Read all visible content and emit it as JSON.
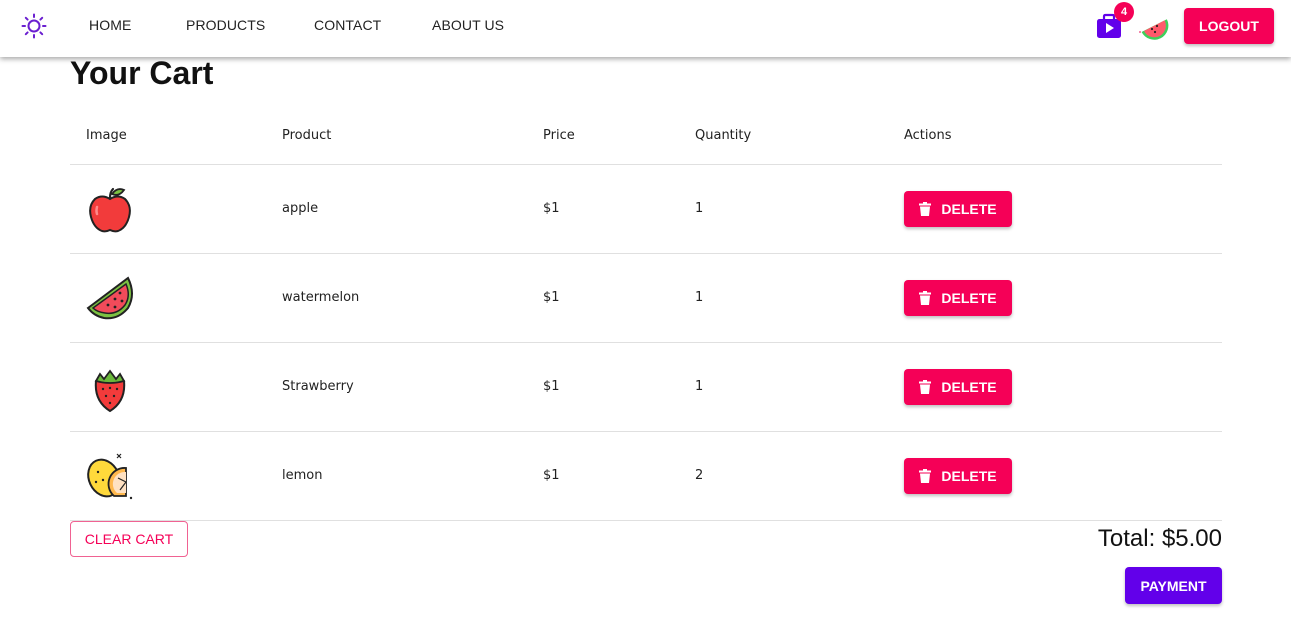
{
  "nav": {
    "logo_icon": "sun-icon",
    "links": [
      "HOME",
      "PRODUCTS",
      "CONTACT",
      "ABOUT US"
    ],
    "cart_icon": "shopping-bag-icon",
    "cart_count": "4",
    "avatar_icon": "watermelon-icon",
    "logout_label": "LOGOUT"
  },
  "page_title": "Your Cart",
  "table": {
    "headers": [
      "Image",
      "Product",
      "Price",
      "Quantity",
      "Actions"
    ],
    "rows": [
      {
        "icon": "apple-icon",
        "product": "apple",
        "price": "$1",
        "quantity": "1",
        "action": "DELETE"
      },
      {
        "icon": "watermelon-icon",
        "product": "watermelon",
        "price": "$1",
        "quantity": "1",
        "action": "DELETE"
      },
      {
        "icon": "strawberry-icon",
        "product": "Strawberry",
        "price": "$1",
        "quantity": "1",
        "action": "DELETE"
      },
      {
        "icon": "lemon-icon",
        "product": "lemon",
        "price": "$1",
        "quantity": "2",
        "action": "DELETE"
      }
    ]
  },
  "clear_cart_label": "CLEAR CART",
  "total_text": "Total: $5.00",
  "payment_label": "PAYMENT",
  "colors": {
    "accent_pink": "#f50057",
    "accent_purple": "#6200ea"
  }
}
